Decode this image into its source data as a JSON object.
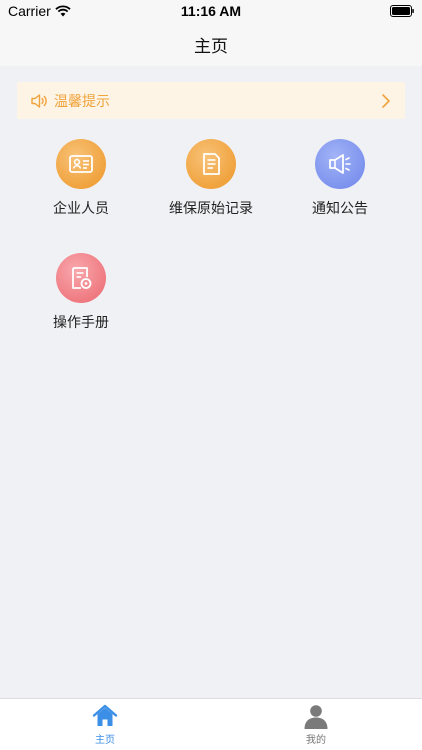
{
  "status_bar": {
    "carrier": "Carrier",
    "time": "11:16 AM"
  },
  "nav": {
    "title": "主页"
  },
  "notice": {
    "label": "温馨提示",
    "icon": "speaker-icon"
  },
  "menu": {
    "items": [
      {
        "label": "企业人员",
        "icon": "id-card-icon",
        "color": "#f0a33e"
      },
      {
        "label": "维保原始记录",
        "icon": "document-icon",
        "color": "#f0a33e"
      },
      {
        "label": "通知公告",
        "icon": "megaphone-icon",
        "color": "#7d93ee"
      },
      {
        "label": "操作手册",
        "icon": "manual-icon",
        "color": "#ef7a81"
      }
    ]
  },
  "tabs": [
    {
      "label": "主页",
      "icon": "home-icon",
      "active": true,
      "color": "#3b8fe6"
    },
    {
      "label": "我的",
      "icon": "person-icon",
      "active": false,
      "color": "#777777"
    }
  ]
}
